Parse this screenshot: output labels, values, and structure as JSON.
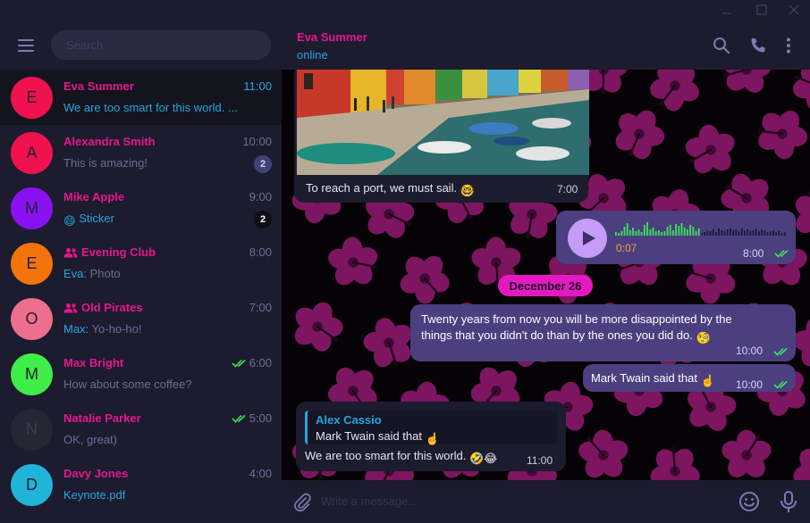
{
  "search": {
    "placeholder": "Search"
  },
  "chats": [
    {
      "initial": "E",
      "avatar_color": "#f0124e",
      "name": "Eva Summer",
      "time": "11:00",
      "preview": "We are too smart for this world. ...",
      "active": true
    },
    {
      "initial": "A",
      "avatar_color": "#f0124e",
      "name": "Alexandra Smith",
      "time": "10:00",
      "preview": "This is amazing!",
      "badge": "2",
      "badge_bg": "#41417a",
      "badge_color": "#d0d0ea"
    },
    {
      "initial": "M",
      "avatar_color": "#8a11f2",
      "name": "Mike Apple",
      "time": "9:00",
      "preview": "Sticker",
      "preview_emoji": "😄",
      "badge": "2",
      "badge_bg": "#0f0f16",
      "badge_color": "#ffffff"
    },
    {
      "initial": "E",
      "avatar_color": "#f5730b",
      "name": "Evening Club",
      "group": true,
      "time": "8:00",
      "preview_sender": "Eva:",
      "preview": "Photo"
    },
    {
      "initial": "O",
      "avatar_color": "#ee6e8e",
      "name": "Old Pirates",
      "group": true,
      "time": "7:00",
      "preview_sender": "Max:",
      "preview": "Yo-ho-ho!"
    },
    {
      "initial": "M",
      "avatar_color": "#40ec47",
      "name": "Max Bright",
      "time": "6:00",
      "read": true,
      "preview": "How about some coffee?"
    },
    {
      "initial": "N",
      "avatar_color": "#262634",
      "name": "Natalie Parker",
      "time": "5:00",
      "read": true,
      "preview": "OK, great)"
    },
    {
      "initial": "D",
      "avatar_color": "#20b5d8",
      "name": "Davy Jones",
      "time": "4:00",
      "preview": "Keynote.pdf",
      "preview_blue": true
    }
  ],
  "header": {
    "peer_name": "Eva Summer",
    "peer_status": "online"
  },
  "messages": {
    "photo_caption": "To reach a port, we must sail.",
    "photo_emoji": "🤓",
    "photo_time": "7:00",
    "voice_duration": "0:07",
    "voice_time": "8:00",
    "date_label": "December 26",
    "long_text": "Twenty years from now you will be more disappointed by the things that you didn't do than by the ones you did do.",
    "long_emoji": "🧐",
    "long_time": "10:00",
    "short_text": "Mark Twain said that",
    "short_emoji": "☝️",
    "short_time": "10:00",
    "reply_author": "Alex Cassio",
    "reply_quote": "Mark Twain said that",
    "reply_quote_emoji": "☝️",
    "reply_text": "We are too smart for this world.",
    "reply_emoji": "🤣😂",
    "reply_time": "11:00"
  },
  "input": {
    "placeholder": "Write a message..."
  },
  "colors": {
    "accent_pink": "#e4178f",
    "accent_blue": "#24a7dc",
    "outgoing_bubble": "#4b3f80",
    "incoming_bubble": "#1c1c2e",
    "read_check": "#3be55b",
    "voice_play": "#c59cf7",
    "voice_duration": "#f0a23a",
    "date_chip": "#e419c1"
  },
  "icons": {
    "menu": "hamburger-icon",
    "search": "search-icon",
    "call": "phone-icon",
    "more": "more-vertical-icon",
    "attach": "paperclip-icon",
    "emoji": "smiley-icon",
    "mic": "microphone-icon",
    "play": "play-icon",
    "read": "double-check-icon",
    "group": "group-icon"
  }
}
